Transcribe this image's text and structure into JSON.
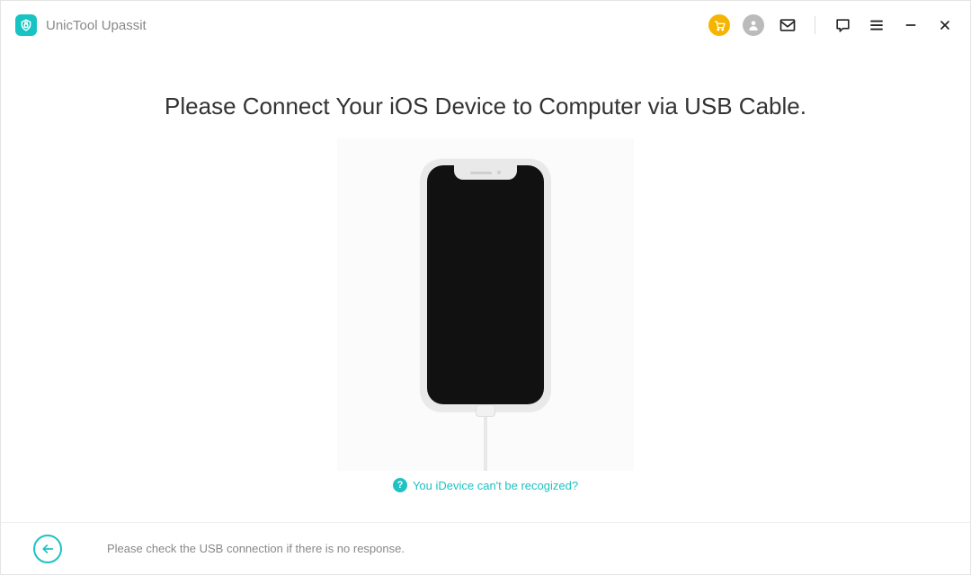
{
  "app": {
    "title": "UnicTool Upassit"
  },
  "main": {
    "headline": "Please Connect Your iOS Device to Computer via USB Cable.",
    "helpText": "You iDevice can't be recogized?"
  },
  "footer": {
    "hint": "Please check the USB connection if there is no response."
  },
  "colors": {
    "accent": "#1ec2c2",
    "cart": "#f5b400"
  }
}
